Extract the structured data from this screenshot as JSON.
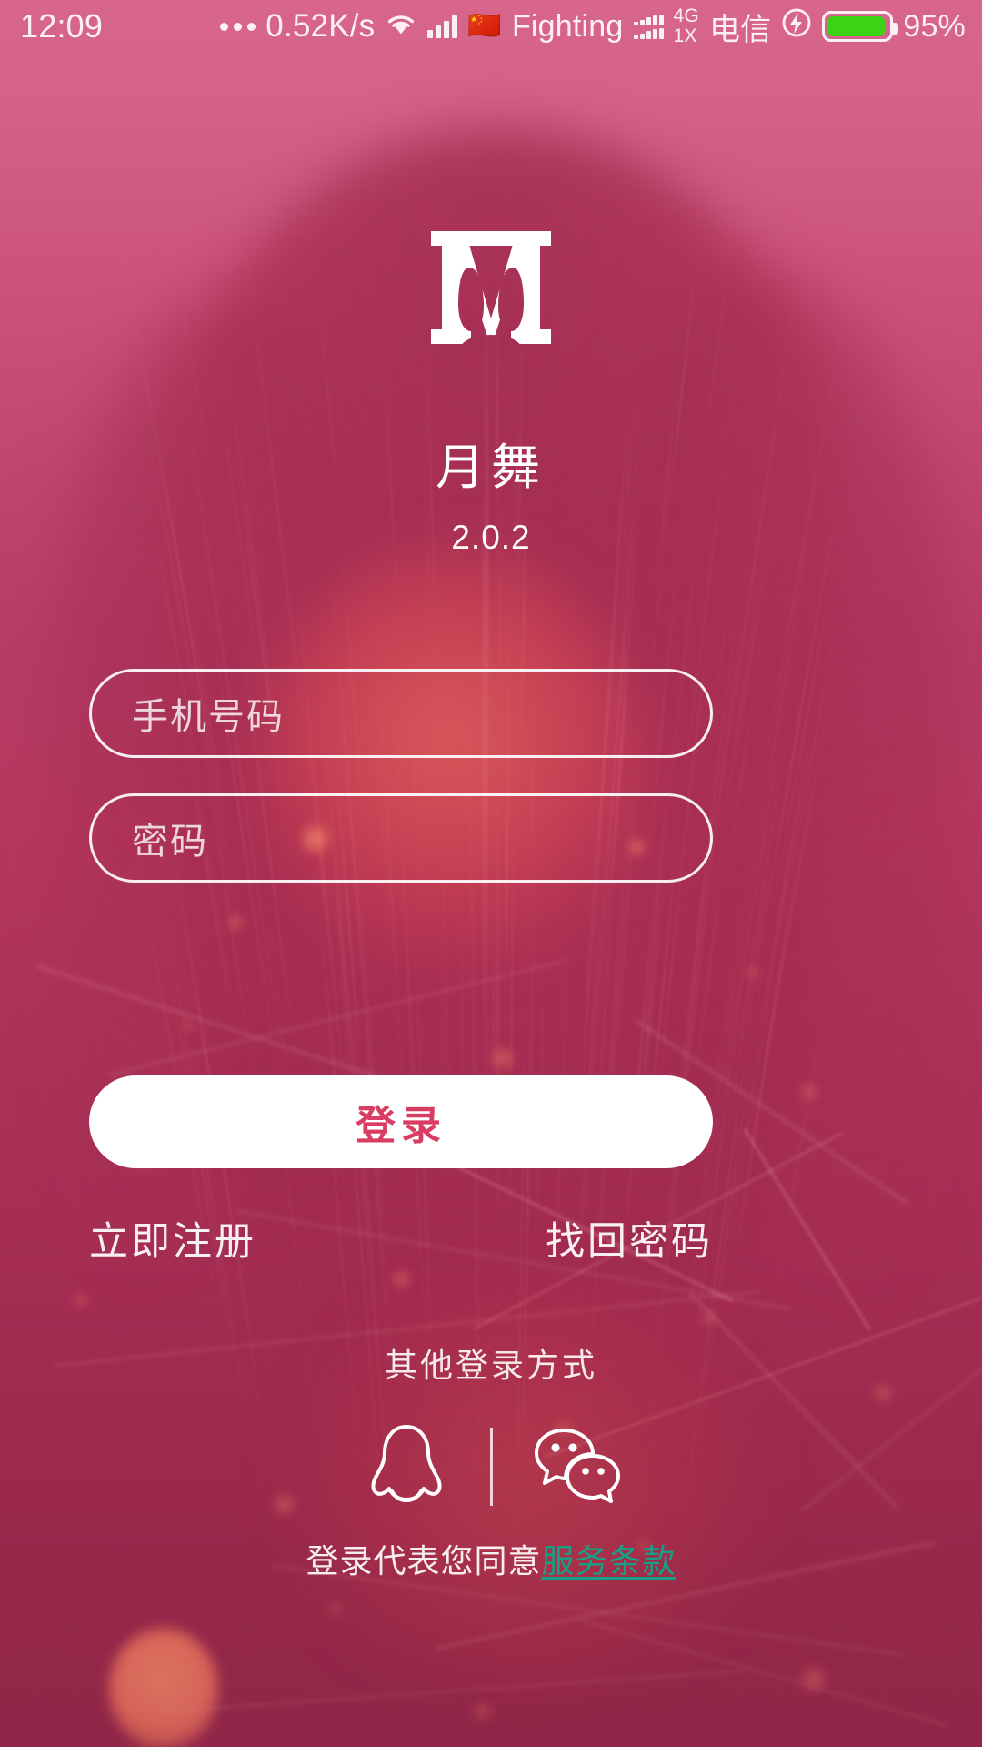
{
  "status_bar": {
    "clock": "12:09",
    "dots_icon": "more-dots-icon",
    "network_speed": "0.52K/s",
    "wifi_icon": "wifi-icon",
    "signal_icon": "signal-bars-icon",
    "flag_icon": "china-flag-icon",
    "sim_label": "Fighting",
    "dual_signal_icon": "dual-signal-bars-icon",
    "network_type_primary": "4G",
    "network_type_secondary": "1X",
    "carrier": "电信",
    "charging_icon": "charging-bolt-icon",
    "battery_icon": "battery-icon",
    "battery_percent": "95%",
    "battery_level": 95,
    "battery_color": "#3cd317",
    "text_color": "#fdf0f4"
  },
  "brand": {
    "logo_icon": "app-logo-m-icon",
    "app_name": "月舞",
    "version": "2.0.2"
  },
  "form": {
    "phone": {
      "placeholder": "手机号码",
      "value": ""
    },
    "password": {
      "placeholder": "密码",
      "value": ""
    },
    "login_button": "登录"
  },
  "links": {
    "register": "立即注册",
    "forgot_password": "找回密码"
  },
  "social": {
    "label": "其他登录方式",
    "qq_icon": "qq-penguin-icon",
    "wechat_icon": "wechat-bubbles-icon"
  },
  "terms": {
    "prefix": "登录代表您同意",
    "link": "服务条款",
    "link_color": "#17a085"
  },
  "theme": {
    "background_top": "#d96a90",
    "background_bottom": "#92284a",
    "accent": "#d93d63",
    "button_background": "#ffffff",
    "field_border": "rgba(255,255,255,0.92)"
  }
}
